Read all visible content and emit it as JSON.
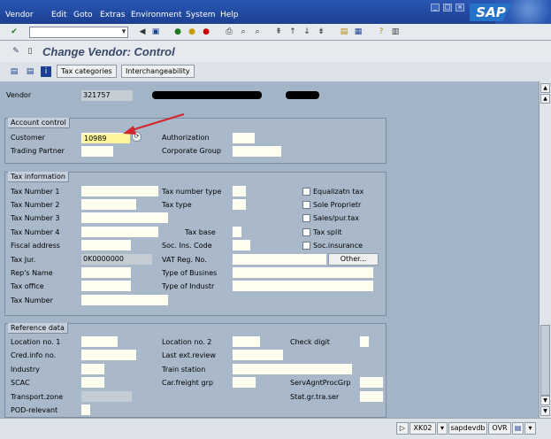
{
  "menu": [
    "Vendor",
    "Edit",
    "Goto",
    "Extras",
    "Environment",
    "System",
    "Help"
  ],
  "logo": "SAP",
  "title": "Change Vendor: Control",
  "app_buttons": [
    "Tax categories",
    "Interchangeability"
  ],
  "vendor": {
    "label": "Vendor",
    "value": "321757"
  },
  "account_control": {
    "title": "Account control",
    "customer_label": "Customer",
    "customer_value": "10989",
    "trading_partner_label": "Trading Partner",
    "authorization_label": "Authorization",
    "corporate_group_label": "Corporate Group"
  },
  "tax_information": {
    "title": "Tax information",
    "tax1": "Tax Number 1",
    "tax2": "Tax Number 2",
    "tax3": "Tax Number 3",
    "tax4": "Tax Number 4",
    "fiscal_address": "Fiscal address",
    "tax_jur": "Tax Jur.",
    "tax_jur_value": "0K0000000",
    "reps_name": "Rep's Name",
    "tax_office": "Tax office",
    "tax_number": "Tax Number",
    "tax_number_type": "Tax number type",
    "tax_type": "Tax type",
    "tax_base": "Tax base",
    "soc_ins_code": "Soc. Ins. Code",
    "vat_reg_no": "VAT Reg. No.",
    "type_of_busines": "Type of Busines",
    "type_of_industr": "Type of Industr",
    "other_button": "Other...",
    "checkboxes": [
      "Equalizatn tax",
      "Sole Proprietr",
      "Sales/pur.tax",
      "Tax split",
      "Soc.insurance"
    ]
  },
  "reference_data": {
    "title": "Reference data",
    "location_no_1": "Location no. 1",
    "cred_info_no": "Cred.info no.",
    "industry": "Industry",
    "scac": "SCAC",
    "transport_zone": "Transport.zone",
    "pod_relevant": "POD-relevant",
    "location_no_2": "Location no. 2",
    "last_ext_review": "Last ext.review",
    "train_station": "Train station",
    "car_freight_grp": "Car.freight grp",
    "check_digit": "Check digit",
    "serv_agnt_proc_grp": "ServAgntProcGrp",
    "stat_gr_tra_ser": "Stat.gr.tra.ser"
  },
  "status": {
    "transaction": "XK02",
    "server": "sapdevdb",
    "mode": "OVR"
  }
}
